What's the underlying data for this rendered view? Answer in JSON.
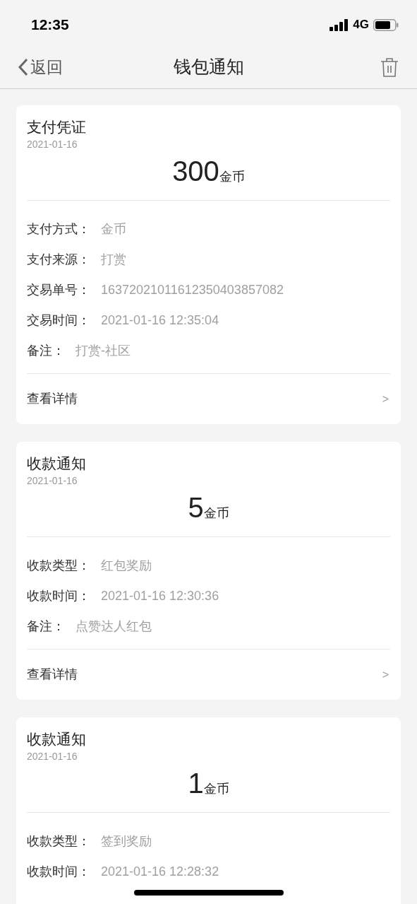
{
  "status_bar": {
    "time": "12:35",
    "network": "4G"
  },
  "nav": {
    "back": "返回",
    "title": "钱包通知"
  },
  "cards": [
    {
      "title": "支付凭证",
      "date": "2021-01-16",
      "amount": "300",
      "unit": "金币",
      "fields": [
        {
          "label": "支付方式：",
          "value": "金币"
        },
        {
          "label": "支付来源：",
          "value": "打赏"
        },
        {
          "label": "交易单号：",
          "value": "16372021011612350403857082"
        },
        {
          "label": "交易时间：",
          "value": "2021-01-16 12:35:04"
        },
        {
          "label": "备注：",
          "value": "打赏-社区"
        }
      ],
      "link": {
        "label": "查看详情",
        "arrow": ">"
      }
    },
    {
      "title": "收款通知",
      "date": "2021-01-16",
      "amount": "5",
      "unit": "金币",
      "fields": [
        {
          "label": "收款类型：",
          "value": "红包奖励"
        },
        {
          "label": "收款时间：",
          "value": "2021-01-16 12:30:36"
        },
        {
          "label": "备注：",
          "value": "点赞达人红包"
        }
      ],
      "link": {
        "label": "查看详情",
        "arrow": ">"
      }
    },
    {
      "title": "收款通知",
      "date": "2021-01-16",
      "amount": "1",
      "unit": "金币",
      "fields": [
        {
          "label": "收款类型：",
          "value": "签到奖励"
        },
        {
          "label": "收款时间：",
          "value": "2021-01-16 12:28:32"
        }
      ]
    }
  ]
}
